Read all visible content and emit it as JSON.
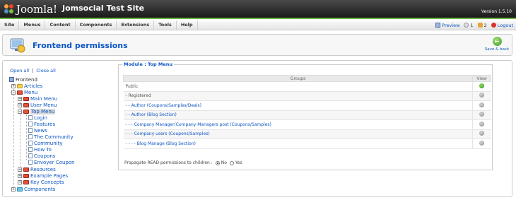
{
  "header": {
    "logo_text": "Joomla!",
    "site_title": "Jomsocial Test Site",
    "version": "Version 1.5.10"
  },
  "menu": {
    "items": [
      "Site",
      "Menus",
      "Content",
      "Components",
      "Extensions",
      "Tools",
      "Help"
    ]
  },
  "status": {
    "preview": "Preview",
    "messages_count": "1",
    "users_count": "2",
    "logout": "Logout"
  },
  "toolbar": {
    "title": "Frontend permissions",
    "save_label": "Save & back"
  },
  "tree": {
    "open_all": "Open all",
    "separator": "|",
    "close_all": "Close all",
    "nodes": [
      {
        "label": "Frontend"
      },
      {
        "label": "Articles"
      },
      {
        "label": "Menu"
      },
      {
        "label": "Main Menu"
      },
      {
        "label": "User Menu"
      },
      {
        "label": "Top Menu"
      },
      {
        "label": "Login"
      },
      {
        "label": "Features"
      },
      {
        "label": "News"
      },
      {
        "label": "The Community"
      },
      {
        "label": "Community"
      },
      {
        "label": "How To"
      },
      {
        "label": "Coupons"
      },
      {
        "label": "Envoyer Coupon"
      },
      {
        "label": "Resources"
      },
      {
        "label": "Example Pages"
      },
      {
        "label": "Key Concepts"
      },
      {
        "label": "Components"
      }
    ]
  },
  "module": {
    "legend": "Module : Top Menu",
    "columns": [
      "Groups",
      "View"
    ],
    "rows": [
      {
        "group": "Public",
        "view": "green"
      },
      {
        "group": "- Registered",
        "view": "grey"
      },
      {
        "group": "- - Author (Coupons/Samples/Deals)",
        "view": "grey"
      },
      {
        "group": "- - Author (Blog Section)",
        "view": "grey"
      },
      {
        "group": "- - - Company Manager(Company Managers post (Coupons/Samples)",
        "view": "grey"
      },
      {
        "group": "- - - Company users (Coupons/Samples)",
        "view": "grey"
      },
      {
        "group": "- - - - Blog Manage (Blog Section)",
        "view": "grey"
      }
    ],
    "propagate_label": "Propagate READ permissions to children :",
    "no_label": "No",
    "yes_label": "Yes"
  },
  "colors": {
    "accent_blue": "#0b55c4",
    "header_green": "#6db33f"
  }
}
